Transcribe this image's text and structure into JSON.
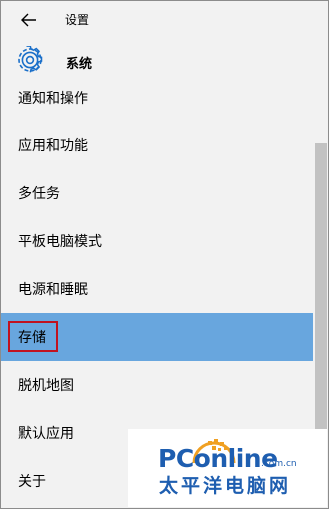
{
  "titlebar": {
    "back_icon": "arrow-left-icon",
    "title": "设置"
  },
  "section": {
    "icon": "gear-icon",
    "title": "系统"
  },
  "nav_items": [
    {
      "label": "通知和操作",
      "active": false
    },
    {
      "label": "应用和功能",
      "active": false
    },
    {
      "label": "多任务",
      "active": false
    },
    {
      "label": "平板电脑模式",
      "active": false
    },
    {
      "label": "电源和睡眠",
      "active": false
    },
    {
      "label": "存储",
      "active": true
    },
    {
      "label": "脱机地图",
      "active": false
    },
    {
      "label": "默认应用",
      "active": false
    },
    {
      "label": "关于",
      "active": false
    }
  ],
  "colors": {
    "accent": "#68a6de",
    "highlight_box": "#c1121f",
    "background": "#f2f2f2"
  },
  "watermark": {
    "brand": "PConline",
    "domain": ".com.cn",
    "cn": "太平洋电脑网"
  }
}
